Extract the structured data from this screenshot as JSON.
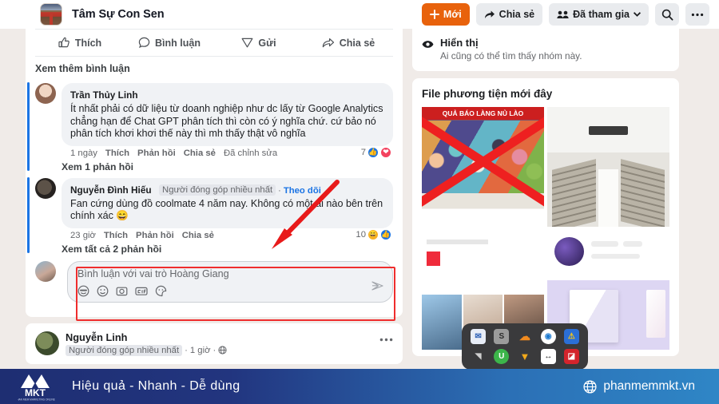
{
  "header": {
    "group_name": "Tâm Sự Con Sen",
    "avatar_icon": "group-photo-avatar",
    "actions": [
      {
        "id": "new",
        "label": "Mới",
        "icon": "plus-icon",
        "style": "primary"
      },
      {
        "id": "share",
        "label": "Chia sẻ",
        "icon": "share-arrow-icon",
        "style": "default"
      },
      {
        "id": "joined",
        "label": "Đã tham gia",
        "icon": "people-icon",
        "trailing_icon": "chevron-down-icon",
        "style": "default"
      },
      {
        "id": "search",
        "label": "",
        "icon": "search-icon",
        "style": "icon"
      },
      {
        "id": "more",
        "label": "",
        "icon": "ellipsis-icon",
        "style": "icon"
      }
    ]
  },
  "post_actions": [
    {
      "label": "Thích",
      "icon": "thumbs-up-icon"
    },
    {
      "label": "Bình luận",
      "icon": "comment-bubble-icon"
    },
    {
      "label": "Gửi",
      "icon": "send-icon"
    },
    {
      "label": "Chia sẻ",
      "icon": "share-arrow-icon"
    }
  ],
  "view_more_comments": "Xem thêm bình luận",
  "comments": [
    {
      "author": "Trần Thủy Linh",
      "avatar": "woman-avatar",
      "text": "Ít nhất phải có dữ liệu từ doanh nghiệp như dc lấy từ Google Analytics chẳng hạn để Chat GPT phân tích thì còn có ý nghĩa chứ. cứ bảo nó phân tích khơi khơi thế này thì mh thấy thật vô nghĩa",
      "time": "1 ngày",
      "like": "Thích",
      "reply": "Phản hồi",
      "share": "Chia sẻ",
      "edited": "Đã chỉnh sửa",
      "reaction_count": "7",
      "reaction_icons": [
        "like",
        "love"
      ],
      "replies_link": "Xem 1 phản hồi"
    },
    {
      "author": "Nguyễn Đình Hiếu",
      "avatar": "man-avatar",
      "badge": "Người đóng góp nhiều nhất",
      "follow": "Theo dõi",
      "text": "Fan cứng dùng đồ coolmate 4 năm nay. Không có một ai nào bên trên chính xác 😄",
      "time": "23 giờ",
      "like": "Thích",
      "reply": "Phản hồi",
      "share": "Chia sẻ",
      "reaction_count": "10",
      "reaction_icons": [
        "haha",
        "like"
      ],
      "replies_link": "Xem tất cả 2 phản hồi"
    }
  ],
  "composer": {
    "avatar": "user-avatar",
    "placeholder": "Bình luận với vai trò Hoàng Giang",
    "icons": [
      "emoji-face-icon",
      "smiley-icon",
      "camera-icon",
      "gif-icon",
      "sticker-icon"
    ],
    "send_icon": "send-plane-icon"
  },
  "bottom_post": {
    "author": "Nguyễn Linh",
    "avatar": "nature-avatar",
    "badge": "Người đóng góp nhiều nhất",
    "time": "1 giờ",
    "privacy_icon": "globe-icon",
    "menu_icon": "ellipsis-icon"
  },
  "rail": {
    "visibility": {
      "icon": "eye-icon",
      "title": "Hiển thị",
      "subtitle": "Ai cũng có thể tìm thấy nhóm này."
    },
    "media": {
      "title": "File phương tiện mới đây",
      "tiles": [
        {
          "id": "tile-1",
          "caption": "QUẢ BÁO LÀNG NỦ LÀO"
        },
        {
          "id": "tile-2",
          "caption": ""
        },
        {
          "id": "tile-3",
          "caption": ""
        },
        {
          "id": "tile-4",
          "caption": ""
        }
      ]
    }
  },
  "dock": {
    "items": [
      {
        "id": "mail",
        "label": "✉",
        "color": "#e8edf7",
        "text": "#2b5fb5"
      },
      {
        "id": "app-s",
        "label": "S",
        "color": "#9b9b9b",
        "text": "#2b2b2b"
      },
      {
        "id": "cloud",
        "label": "☁",
        "color": "#3a3a3c",
        "text": "#f08a1f"
      },
      {
        "id": "browser",
        "label": "◉",
        "color": "#ffffff",
        "text": "#1f7bd1"
      },
      {
        "id": "security",
        "label": "⚠",
        "color": "#2b6fd6",
        "text": "#f5c518"
      },
      {
        "id": "mute",
        "label": "◤",
        "color": "#3a3a3c",
        "text": "#cfcfcf"
      },
      {
        "id": "voice",
        "label": "U",
        "color": "#3cb54a",
        "text": "#ffffff"
      },
      {
        "id": "funnel",
        "label": "▼",
        "color": "#3a3a3c",
        "text": "#f2a91b"
      },
      {
        "id": "resize",
        "label": "↔",
        "color": "#ffffff",
        "text": "#1a1a1a"
      },
      {
        "id": "adobe",
        "label": "A",
        "color": "#d4242c",
        "text": "#ffffff"
      }
    ]
  },
  "brand": {
    "logo_text": "MKT",
    "logo_sub": "PHAN MEM MARKETING ONLINE",
    "slogan": "Hiệu quả - Nhanh - Dễ dùng",
    "website": "phanmemmkt.vn",
    "globe_icon": "globe-icon"
  }
}
